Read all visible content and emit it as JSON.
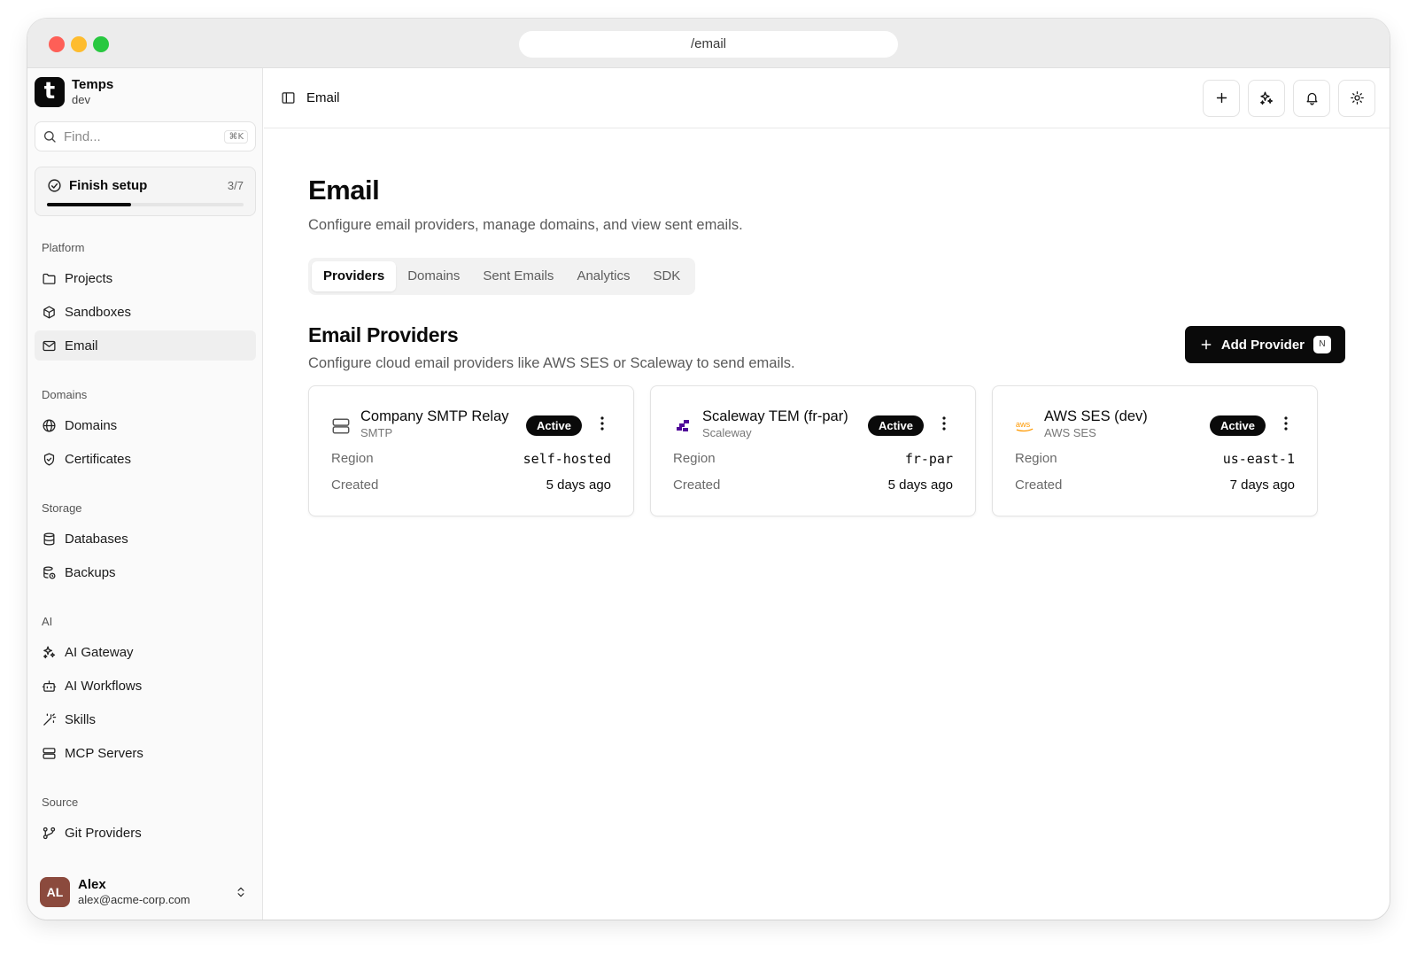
{
  "browser": {
    "url": "/email"
  },
  "brand": {
    "logo_letter": "t",
    "name": "Temps",
    "env": "dev"
  },
  "search": {
    "placeholder": "Find...",
    "shortcut": "⌘K"
  },
  "setup": {
    "label": "Finish setup",
    "count": "3/7",
    "progress": 0.43
  },
  "nav": {
    "groups": [
      {
        "label": "Platform",
        "items": [
          {
            "label": "Projects",
            "icon": "folder-icon"
          },
          {
            "label": "Sandboxes",
            "icon": "box-icon"
          },
          {
            "label": "Email",
            "icon": "mail-icon",
            "active": true
          }
        ]
      },
      {
        "label": "Domains",
        "items": [
          {
            "label": "Domains",
            "icon": "globe-icon"
          },
          {
            "label": "Certificates",
            "icon": "shield-icon"
          }
        ]
      },
      {
        "label": "Storage",
        "items": [
          {
            "label": "Databases",
            "icon": "database-icon"
          },
          {
            "label": "Backups",
            "icon": "backup-icon"
          }
        ]
      },
      {
        "label": "AI",
        "items": [
          {
            "label": "AI Gateway",
            "icon": "sparkles-icon"
          },
          {
            "label": "AI Workflows",
            "icon": "bot-icon"
          },
          {
            "label": "Skills",
            "icon": "wand-icon"
          },
          {
            "label": "MCP Servers",
            "icon": "server-icon"
          }
        ]
      },
      {
        "label": "Source",
        "items": [
          {
            "label": "Git Providers",
            "icon": "git-branch-icon"
          }
        ]
      }
    ]
  },
  "user": {
    "initials": "AL",
    "name": "Alex",
    "email": "alex@acme-corp.com"
  },
  "topbar": {
    "breadcrumb": "Email"
  },
  "page": {
    "title": "Email",
    "subtitle": "Configure email providers, manage domains, and view sent emails.",
    "tabs": [
      {
        "label": "Providers",
        "active": true
      },
      {
        "label": "Domains"
      },
      {
        "label": "Sent Emails"
      },
      {
        "label": "Analytics"
      },
      {
        "label": "SDK"
      }
    ]
  },
  "providers": {
    "title": "Email Providers",
    "subtitle": "Configure cloud email providers like AWS SES or Scaleway to send emails.",
    "add_label": "Add Provider",
    "add_shortcut": "N",
    "region_label": "Region",
    "created_label": "Created",
    "items": [
      {
        "name": "Company SMTP Relay",
        "type": "SMTP",
        "status": "Active",
        "region": "self-hosted",
        "created": "5 days ago",
        "icon": "server-icon"
      },
      {
        "name": "Scaleway TEM (fr-par)",
        "type": "Scaleway",
        "status": "Active",
        "region": "fr-par",
        "created": "5 days ago",
        "icon": "scaleway-logo-icon"
      },
      {
        "name": "AWS SES (dev)",
        "type": "AWS SES",
        "status": "Active",
        "region": "us-east-1",
        "created": "7 days ago",
        "icon": "aws-logo-icon"
      }
    ]
  },
  "colors": {
    "accent": "#0a0a0a",
    "scaleway": "#4f0599",
    "aws": "#ff9900",
    "avatar": "#8b4a3d"
  }
}
